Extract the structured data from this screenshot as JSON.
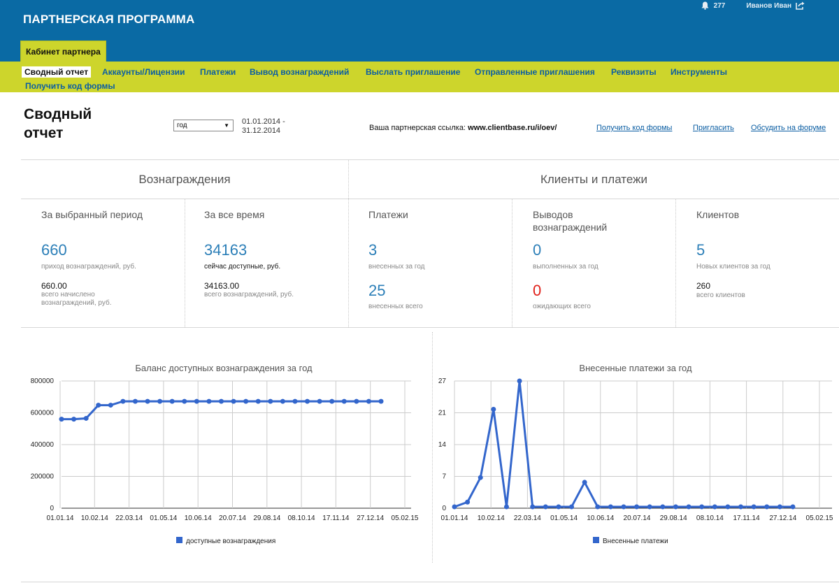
{
  "header": {
    "app_title": "ПАРТНЕРСКАЯ ПРОГРАММА",
    "notifications_count": "277",
    "user_name": "Иванов Иван",
    "cabinet_tab": "Кабинет партнера"
  },
  "nav": {
    "items": [
      {
        "label": "Сводный отчет",
        "active": true
      },
      {
        "label": "Аккаунты/Лицензии"
      },
      {
        "label": "Платежи"
      },
      {
        "label": "Вывод вознаграждений"
      },
      {
        "label": "Выслать приглашение"
      },
      {
        "label": "Отправленные приглашения"
      },
      {
        "label": "Реквизиты"
      },
      {
        "label": "Инструменты"
      },
      {
        "label": "Получить код формы"
      }
    ]
  },
  "page": {
    "title": "Сводный отчет",
    "period_selected": "год",
    "date_from": "01.01.2014 -",
    "date_to": "31.12.2014",
    "ref_label": "Ваша партнерская ссылка:",
    "ref_url": "www.clientbase.ru/i/oev/",
    "links": [
      "Получить код формы",
      "Пригласить",
      "Обсудить на форуме"
    ]
  },
  "stats": {
    "rewards_title": "Вознаграждения",
    "clients_title": "Клиенты и платежи",
    "period": {
      "head": "За выбранный период",
      "value": "660",
      "caption": "приход вознаграждений, руб.",
      "sub_value": "660.00",
      "sub_caption": "всего начислено вознаграждений, руб."
    },
    "all_time": {
      "head": "За все время",
      "value": "34163",
      "caption": "сейчас доступные, руб.",
      "sub_value": "34163.00",
      "sub_caption": "всего вознаграждений, руб."
    },
    "payments": {
      "head": "Платежи",
      "value": "3",
      "caption": "внесенных за год",
      "value2": "25",
      "caption2": "внесенных всего"
    },
    "withdrawals": {
      "head": "Выводов вознаграждений",
      "value": "0",
      "caption": "выполненных за год",
      "value2": "0",
      "caption2": "ожидающих всего"
    },
    "clients": {
      "head": "Клиентов",
      "value": "5",
      "caption": "Новых клиентов за год",
      "sub_value": "260",
      "sub_caption": "всего клиентов"
    }
  },
  "chart_data": [
    {
      "type": "line",
      "title": "Баланс доступных вознаграждения за год",
      "x_ticks": [
        "01.01.14",
        "10.02.14",
        "22.03.14",
        "01.05.14",
        "10.06.14",
        "20.07.14",
        "29.08.14",
        "08.10.14",
        "17.11.14",
        "27.12.14",
        "05.02.15"
      ],
      "y_ticks": [
        "800000",
        "600000",
        "400000",
        "200000",
        "0"
      ],
      "ylim": [
        0,
        800000
      ],
      "series": [
        {
          "name": "доступные вознаграждения",
          "color": "#3366cc",
          "values": [
            560000,
            560000,
            565000,
            648000,
            648000,
            672000,
            672000,
            672000,
            672000,
            672000,
            672000,
            672000,
            672000,
            672000,
            672000,
            672000,
            672000,
            672000,
            672000,
            672000,
            672000,
            672000,
            672000,
            672000,
            672000,
            672000,
            672000
          ]
        }
      ]
    },
    {
      "type": "line",
      "title": "Внесенные платежи за год",
      "x_ticks": [
        "01.01.14",
        "10.02.14",
        "22.03.14",
        "01.05.14",
        "10.06.14",
        "20.07.14",
        "29.08.14",
        "08.10.14",
        "17.11.14",
        "27.12.14",
        "05.02.15"
      ],
      "y_ticks": [
        "27",
        "21",
        "14",
        "7",
        "0"
      ],
      "ylim": [
        0,
        27
      ],
      "series": [
        {
          "name": "Внесенные платежи",
          "color": "#3366cc",
          "values": [
            0.3,
            1.3,
            6.5,
            21,
            0.3,
            27,
            0.3,
            0.3,
            0.3,
            0.3,
            5.5,
            0.3,
            0.3,
            0.3,
            0.3,
            0.3,
            0.3,
            0.3,
            0.3,
            0.3,
            0.3,
            0.3,
            0.3,
            0.3,
            0.3,
            0.3,
            0.3
          ]
        }
      ]
    }
  ]
}
